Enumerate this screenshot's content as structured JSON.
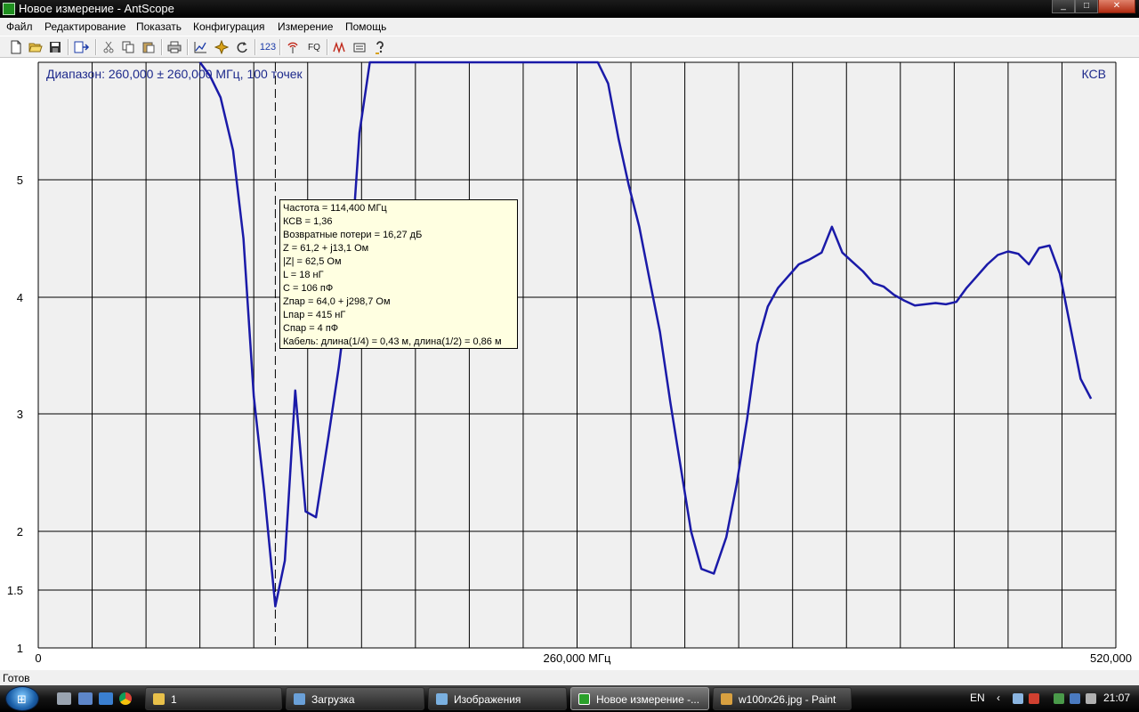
{
  "window": {
    "title": "Новое измерение - AntScope",
    "buttons": [
      "_",
      "□",
      "✕"
    ]
  },
  "menu": {
    "items": [
      "Файл",
      "Редактирование",
      "Показать",
      "Конфигурация",
      "Измерение",
      "Помощь"
    ]
  },
  "toolbar": {
    "icons": [
      "new-file-icon",
      "open-folder-icon",
      "save-icon",
      "export-icon",
      "cut-icon",
      "copy-icon",
      "paste-icon",
      "print-icon",
      "chart-icon",
      "settings-icon",
      "refresh-icon",
      "number-icon",
      "antenna-icon",
      "fq-icon",
      "markers-icon",
      "folder-open-icon",
      "help-icon"
    ],
    "number_label": "123",
    "fq_label": "FQ"
  },
  "chart_header": {
    "range_label": "Диапазон: 260,000 ± 260,000 МГц, 100 точек",
    "mode_label": "КСВ"
  },
  "colors": {
    "series": "#1a1aa8",
    "label": "#1e2a8c",
    "grid": "#000000",
    "plot_bg": "#f0f0f0",
    "tooltip_bg": "#ffffe1"
  },
  "chart_data": {
    "type": "line",
    "xlim": [
      0,
      520
    ],
    "ylim": [
      1,
      6
    ],
    "yticks": [
      1,
      1.5,
      2,
      3,
      4,
      5
    ],
    "ytick_labels": [
      "1",
      "1.5",
      "2",
      "3",
      "4",
      "5"
    ],
    "xtick_labels": [
      {
        "x": 0,
        "label": "0"
      },
      {
        "x": 260,
        "label": "260,000 МГц"
      },
      {
        "x": 520,
        "label": "520,000"
      }
    ],
    "marker_x": 114.4,
    "series": [
      {
        "points": [
          [
            78,
            6.0
          ],
          [
            83,
            5.88
          ],
          [
            88,
            5.7
          ],
          [
            94,
            5.25
          ],
          [
            99,
            4.5
          ],
          [
            104,
            3.15
          ],
          [
            109,
            2.35
          ],
          [
            114.4,
            1.36
          ],
          [
            119,
            1.75
          ],
          [
            124,
            3.2
          ],
          [
            129,
            2.17
          ],
          [
            134,
            2.12
          ],
          [
            140,
            2.8
          ],
          [
            145,
            3.4
          ],
          [
            150,
            4.1
          ],
          [
            155,
            5.4
          ],
          [
            160,
            6.0
          ],
          [
            270,
            6.0
          ],
          [
            275,
            5.82
          ],
          [
            280,
            5.35
          ],
          [
            285,
            4.95
          ],
          [
            290,
            4.6
          ],
          [
            295,
            4.15
          ],
          [
            300,
            3.7
          ],
          [
            305,
            3.1
          ],
          [
            310,
            2.55
          ],
          [
            315,
            2.0
          ],
          [
            320,
            1.68
          ],
          [
            326,
            1.64
          ],
          [
            332,
            1.95
          ],
          [
            337,
            2.4
          ],
          [
            342,
            2.95
          ],
          [
            347,
            3.6
          ],
          [
            352,
            3.92
          ],
          [
            357,
            4.08
          ],
          [
            362,
            4.18
          ],
          [
            367,
            4.28
          ],
          [
            372,
            4.32
          ],
          [
            378,
            4.38
          ],
          [
            383,
            4.6
          ],
          [
            388,
            4.38
          ],
          [
            393,
            4.3
          ],
          [
            398,
            4.22
          ],
          [
            403,
            4.12
          ],
          [
            408,
            4.09
          ],
          [
            413,
            4.02
          ],
          [
            418,
            3.97
          ],
          [
            423,
            3.93
          ],
          [
            428,
            3.94
          ],
          [
            433,
            3.95
          ],
          [
            438,
            3.94
          ],
          [
            443,
            3.96
          ],
          [
            448,
            4.08
          ],
          [
            453,
            4.18
          ],
          [
            458,
            4.28
          ],
          [
            463,
            4.36
          ],
          [
            468,
            4.39
          ],
          [
            473,
            4.37
          ],
          [
            478,
            4.28
          ],
          [
            483,
            4.42
          ],
          [
            488,
            4.44
          ],
          [
            493,
            4.2
          ],
          [
            498,
            3.75
          ],
          [
            503,
            3.3
          ],
          [
            508,
            3.13
          ]
        ]
      }
    ]
  },
  "tooltip": {
    "lines": [
      "Частота = 114,400 МГц",
      "КСВ = 1,36",
      "Возвратные потери = 16,27 дБ",
      "Z = 61,2 + j13,1 Ом",
      "|Z| = 62,5 Ом",
      "L = 18 нГ",
      "C = 106 пФ",
      "Zпар = 64,0 + j298,7 Ом",
      "Lпар = 415 нГ",
      "Cпар = 4 пФ",
      "Кабель: длина(1/4) = 0,43 м, длина(1/2) = 0,86 м"
    ]
  },
  "status": {
    "text": "Готов"
  },
  "taskbar": {
    "tasks": [
      {
        "label": "1",
        "icon": "folder-icon"
      },
      {
        "label": "Загрузка",
        "icon": "download-icon"
      },
      {
        "label": "Изображения",
        "icon": "pictures-icon"
      },
      {
        "label": "Новое измерение -...",
        "icon": "antscope-icon",
        "active": true
      },
      {
        "label": "w100rx26.jpg - Paint",
        "icon": "paint-icon"
      }
    ],
    "lang": "EN",
    "clock": "21:07"
  }
}
